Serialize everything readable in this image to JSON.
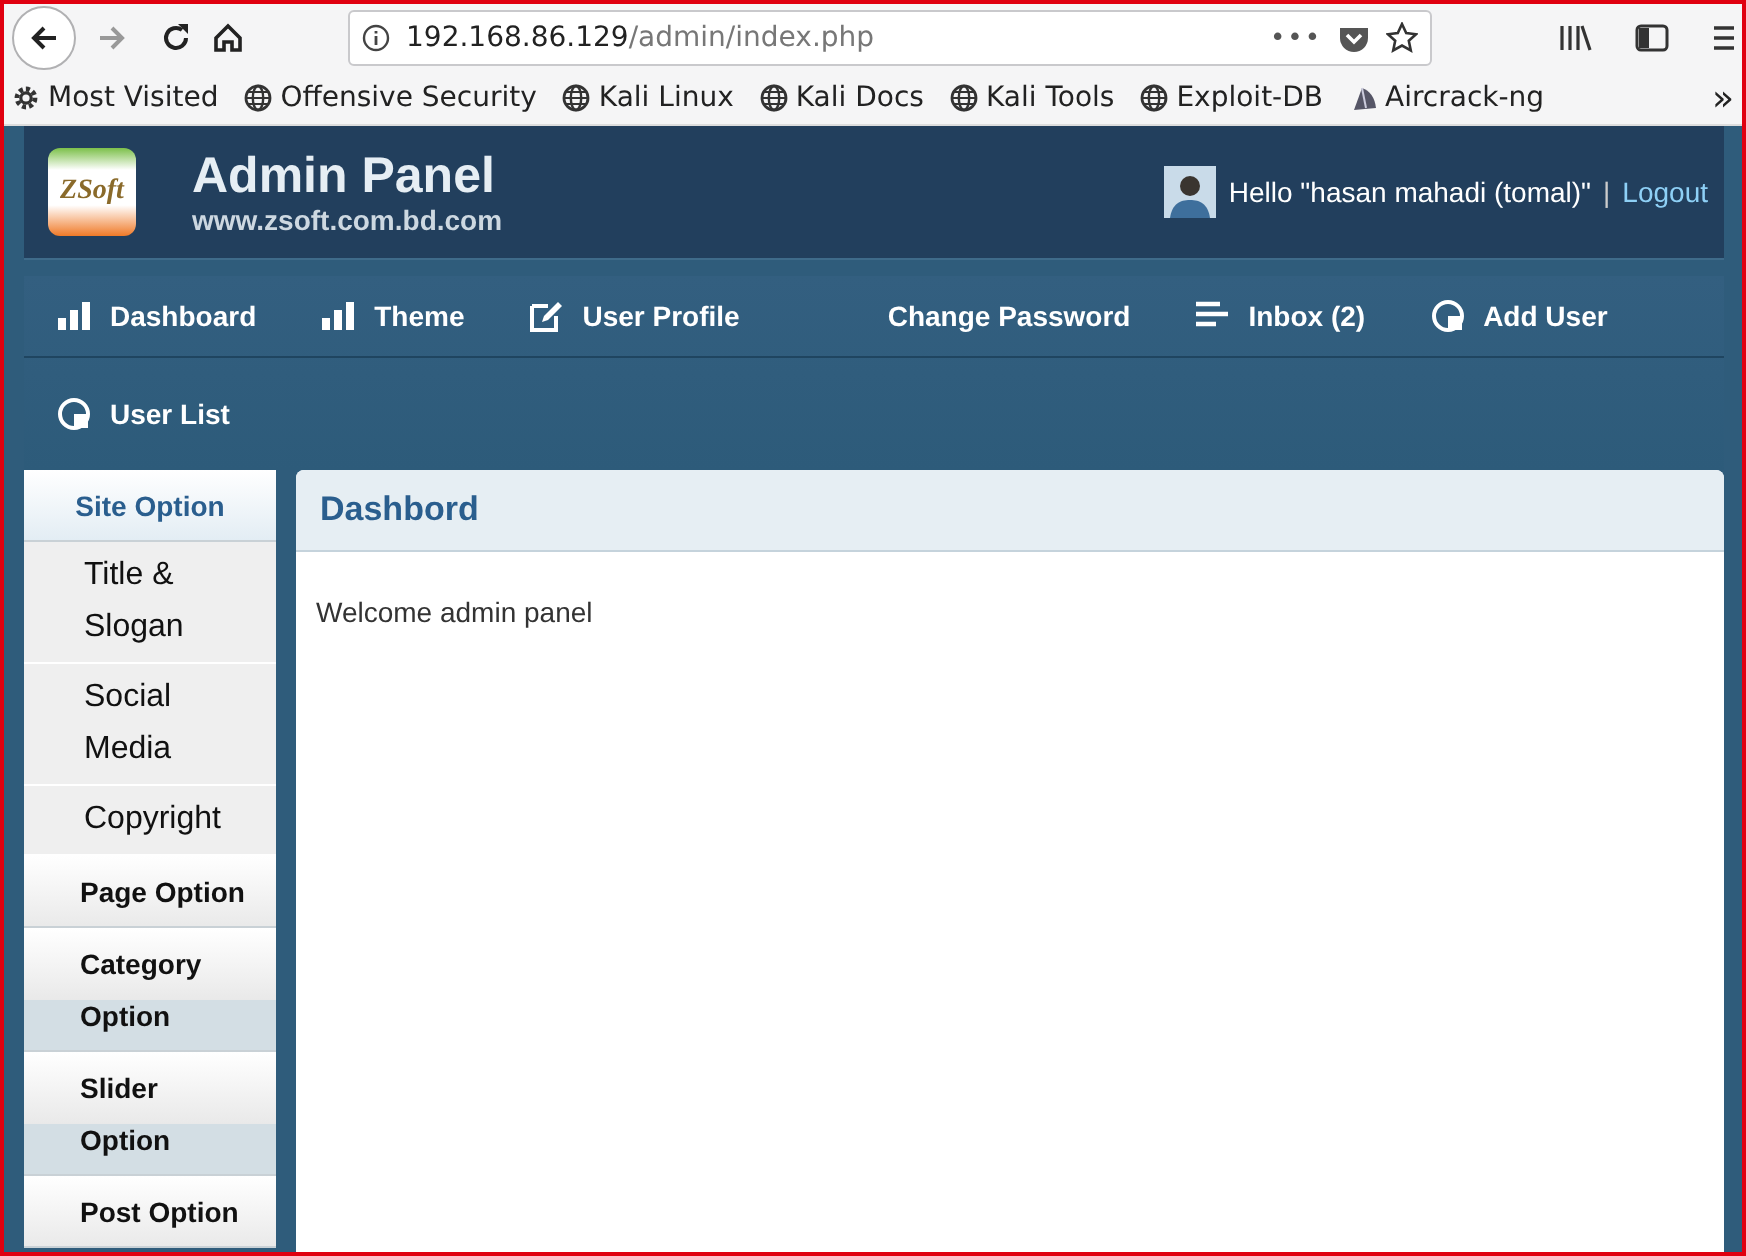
{
  "browser": {
    "url_host": "192.168.86.129",
    "url_path": "/admin/index.php",
    "more": "•••",
    "bookmarks": [
      {
        "label": "Most Visited",
        "kind": "gear"
      },
      {
        "label": "Offensive Security",
        "kind": "globe"
      },
      {
        "label": "Kali Linux",
        "kind": "globe"
      },
      {
        "label": "Kali Docs",
        "kind": "globe"
      },
      {
        "label": "Kali Tools",
        "kind": "globe"
      },
      {
        "label": "Exploit-DB",
        "kind": "globe"
      },
      {
        "label": "Aircrack-ng",
        "kind": "wing"
      }
    ],
    "overflow": "»"
  },
  "header": {
    "logo_text": "ZSoft",
    "title": "Admin Panel",
    "subtitle": "www.zsoft.com.bd.com",
    "greeting": "Hello \"hasan mahadi (tomal)\"",
    "separator": "|",
    "logout": "Logout"
  },
  "nav": [
    {
      "label": "Dashboard",
      "kind": "bars"
    },
    {
      "label": "Theme",
      "kind": "bars"
    },
    {
      "label": "User Profile",
      "kind": "edit"
    },
    {
      "label": "Change Password",
      "kind": "plain"
    },
    {
      "label": "Inbox (2)",
      "kind": "lines"
    },
    {
      "label": "Add User",
      "kind": "pie"
    },
    {
      "label": "User List",
      "kind": "pie"
    }
  ],
  "sidebar": [
    {
      "label": "Site Option",
      "expanded": true,
      "children": [
        {
          "label": "Title & Slogan"
        },
        {
          "label": "Social Media"
        },
        {
          "label": "Copyright"
        }
      ]
    },
    {
      "label": "Page Option",
      "expanded": false
    },
    {
      "label": "Category Option",
      "expanded": false
    },
    {
      "label": "Slider Option",
      "expanded": false
    },
    {
      "label": "Post Option",
      "expanded": false
    }
  ],
  "panel": {
    "title": "Dashbord",
    "body": "Welcome admin panel"
  }
}
